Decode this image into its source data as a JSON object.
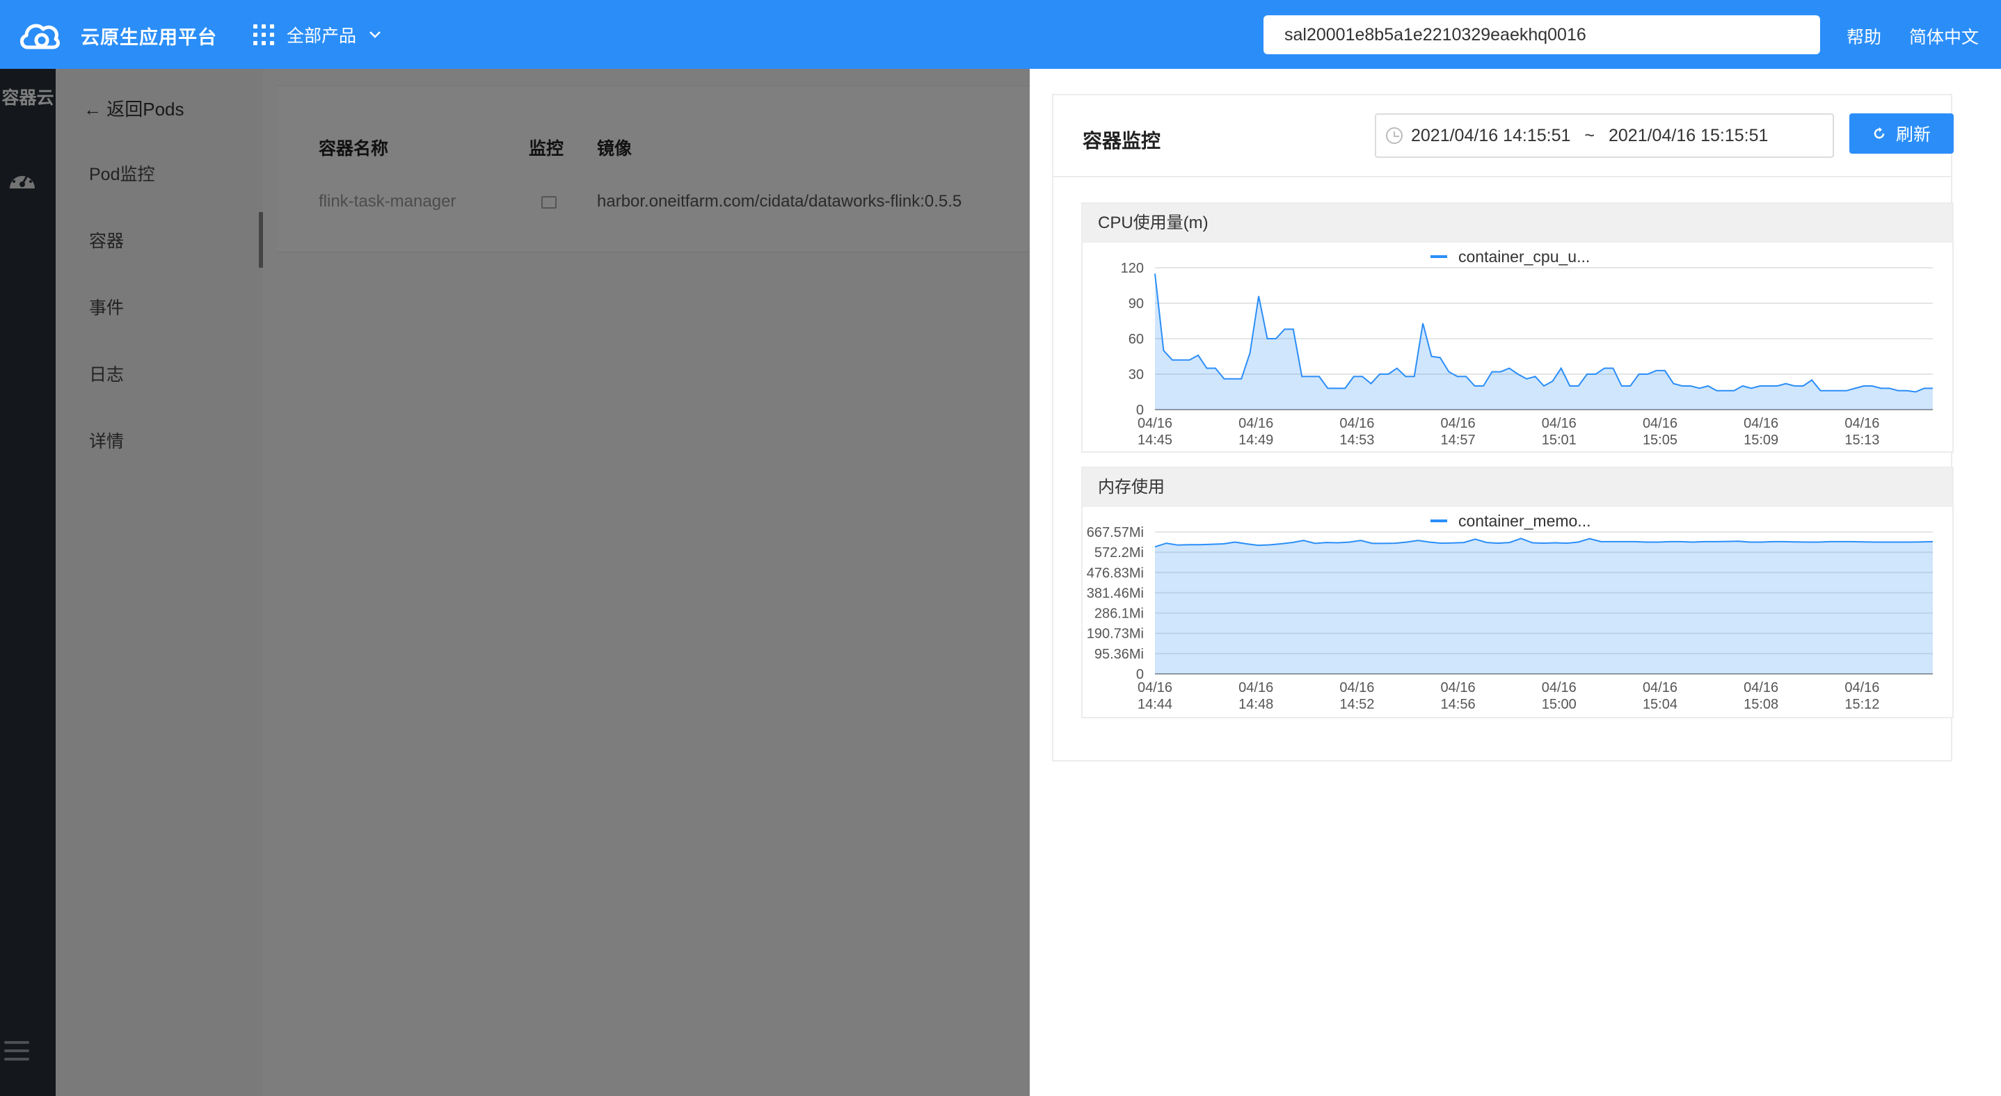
{
  "header": {
    "brand": "云原生应用平台",
    "products_label": "全部产品",
    "search_value": "sal20001e8b5a1e2210329eaekhq0016",
    "help": "帮助",
    "language": "简体中文",
    "accent_color": "#2b8ef8"
  },
  "sidebar": {
    "title": "容器云",
    "dashboard_icon": "dashboard-icon",
    "menu_icon": "menu-icon"
  },
  "submenu": {
    "back_label": "← 返回Pods",
    "items": [
      {
        "label": "Pod监控"
      },
      {
        "label": "容器"
      },
      {
        "label": "事件"
      },
      {
        "label": "日志"
      },
      {
        "label": "详情"
      }
    ],
    "active_index": 1
  },
  "container_table": {
    "columns": [
      "容器名称",
      "监控",
      "镜像"
    ],
    "rows": [
      {
        "name": "flink-task-manager",
        "monitor_icon": "monitor-icon",
        "image": "harbor.oneitfarm.com/cidata/dataworks-flink:0.5.5"
      }
    ]
  },
  "drawer": {
    "title": "容器监控",
    "range_start": "2021/04/16 14:15:51",
    "range_sep": "~",
    "range_end": "2021/04/16 15:15:51",
    "refresh_label": "刷新"
  },
  "chart_data": [
    {
      "type": "area",
      "title": "CPU使用量(m)",
      "legend": "container_cpu_u...",
      "color": "#2b8ef8",
      "ylim": [
        0,
        120
      ],
      "yticks": [
        "120",
        "90",
        "60",
        "30",
        "0"
      ],
      "xticks": [
        [
          "04/16",
          "14:45"
        ],
        [
          "04/16",
          "14:49"
        ],
        [
          "04/16",
          "14:53"
        ],
        [
          "04/16",
          "14:57"
        ],
        [
          "04/16",
          "15:01"
        ],
        [
          "04/16",
          "15:05"
        ],
        [
          "04/16",
          "15:09"
        ],
        [
          "04/16",
          "15:13"
        ]
      ],
      "values": [
        115,
        50,
        42,
        42,
        42,
        46,
        35,
        35,
        26,
        26,
        26,
        48,
        96,
        60,
        60,
        68,
        68,
        28,
        28,
        28,
        18,
        18,
        18,
        28,
        28,
        22,
        30,
        30,
        35,
        28,
        28,
        73,
        45,
        44,
        32,
        28,
        28,
        20,
        20,
        32,
        32,
        35,
        30,
        26,
        28,
        20,
        24,
        35,
        20,
        20,
        30,
        30,
        35,
        35,
        20,
        20,
        30,
        30,
        33,
        33,
        22,
        20,
        20,
        18,
        20,
        16,
        16,
        16,
        20,
        18,
        20,
        20,
        20,
        22,
        20,
        20,
        25,
        16,
        16,
        16,
        16,
        18,
        20,
        20,
        18,
        18,
        16,
        16,
        15,
        18,
        18
      ]
    },
    {
      "type": "area",
      "title": "内存使用",
      "legend": "container_memo...",
      "color": "#2b8ef8",
      "ylim": [
        0,
        667.57
      ],
      "yticks": [
        "667.57Mi",
        "572.2Mi",
        "476.83Mi",
        "381.46Mi",
        "286.1Mi",
        "190.73Mi",
        "95.36Mi",
        "0"
      ],
      "xticks": [
        [
          "04/16",
          "14:44"
        ],
        [
          "04/16",
          "14:48"
        ],
        [
          "04/16",
          "14:52"
        ],
        [
          "04/16",
          "14:56"
        ],
        [
          "04/16",
          "15:00"
        ],
        [
          "04/16",
          "15:04"
        ],
        [
          "04/16",
          "15:08"
        ],
        [
          "04/16",
          "15:12"
        ]
      ],
      "values": [
        598,
        615,
        606,
        608,
        608,
        610,
        612,
        620,
        612,
        605,
        607,
        612,
        618,
        628,
        614,
        618,
        617,
        620,
        628,
        614,
        614,
        615,
        620,
        628,
        620,
        615,
        616,
        618,
        634,
        618,
        615,
        618,
        637,
        617,
        615,
        617,
        615,
        620,
        636,
        622,
        622,
        622,
        622,
        620,
        620,
        622,
        622,
        620,
        622,
        622,
        623,
        624,
        620,
        620,
        622,
        622,
        621,
        620,
        620,
        622,
        622,
        622,
        621,
        620,
        620,
        620,
        620,
        621,
        622
      ]
    }
  ]
}
